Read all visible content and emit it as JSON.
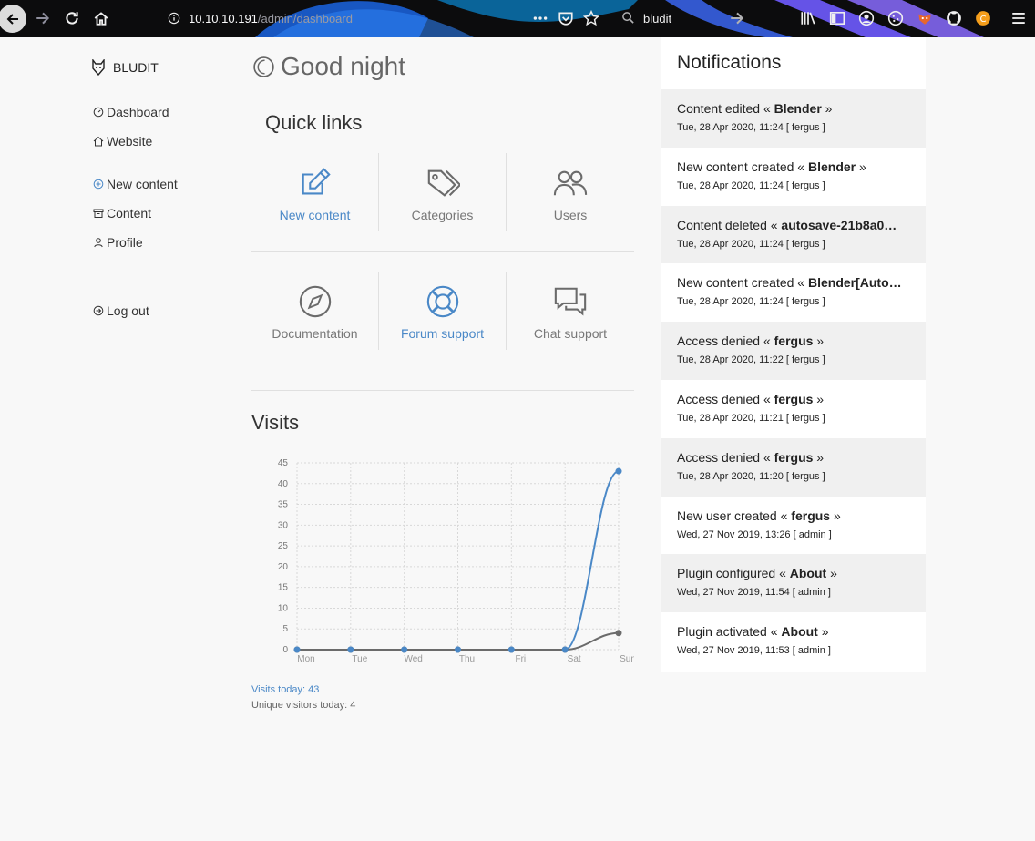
{
  "browser": {
    "url_host": "10.10.10.191",
    "url_path": "/admin/dashboard",
    "search_text": "bludit"
  },
  "sidebar": {
    "brand": "BLUDIT",
    "items": [
      {
        "label": "Dashboard",
        "icon": "dashboard-icon"
      },
      {
        "label": "Website",
        "icon": "home-icon"
      },
      {
        "label": "New content",
        "icon": "plus-circle-icon"
      },
      {
        "label": "Content",
        "icon": "archive-icon"
      },
      {
        "label": "Profile",
        "icon": "user-icon"
      },
      {
        "label": "Log out",
        "icon": "logout-icon"
      }
    ]
  },
  "main": {
    "greeting": "Good night",
    "quick_links_title": "Quick links",
    "quick_links": [
      {
        "label": "New content",
        "icon": "pencil-square-icon"
      },
      {
        "label": "Categories",
        "icon": "tags-icon"
      },
      {
        "label": "Users",
        "icon": "users-icon"
      },
      {
        "label": "Documentation",
        "icon": "compass-icon"
      },
      {
        "label": "Forum support",
        "icon": "life-ring-icon"
      },
      {
        "label": "Chat support",
        "icon": "chat-icon"
      }
    ],
    "visits_title": "Visits",
    "visits_today": "Visits today: 43",
    "unique_today": "Unique visitors today: 4"
  },
  "chart_data": {
    "type": "line",
    "categories": [
      "Mon",
      "Tue",
      "Wed",
      "Thu",
      "Fri",
      "Sat",
      "Sun"
    ],
    "series": [
      {
        "values": [
          0,
          0,
          0,
          0,
          0,
          0,
          43
        ],
        "color": "#4a88c7"
      },
      {
        "values": [
          0,
          0,
          0,
          0,
          0,
          0,
          4
        ],
        "color": "#6b6b6b"
      }
    ],
    "yticks": [
      0,
      5,
      10,
      15,
      20,
      25,
      30,
      35,
      40,
      45
    ],
    "ylim": [
      0,
      45
    ],
    "grid": true
  },
  "notifications": {
    "title": "Notifications",
    "items": [
      {
        "prefix": "Content edited « ",
        "name": "Blender",
        "suffix": " »",
        "meta": "Tue, 28 Apr 2020, 11:24 [ fergus ]"
      },
      {
        "prefix": "New content created « ",
        "name": "Blender",
        "suffix": " »",
        "meta": "Tue, 28 Apr 2020, 11:24 [ fergus ]"
      },
      {
        "prefix": "Content deleted « ",
        "name": "autosave-21b8a0…",
        "suffix": "",
        "meta": "Tue, 28 Apr 2020, 11:24 [ fergus ]"
      },
      {
        "prefix": "New content created « ",
        "name": "Blender[Auto…",
        "suffix": "",
        "meta": "Tue, 28 Apr 2020, 11:24 [ fergus ]"
      },
      {
        "prefix": "Access denied « ",
        "name": "fergus",
        "suffix": " »",
        "meta": "Tue, 28 Apr 2020, 11:22 [ fergus ]"
      },
      {
        "prefix": "Access denied « ",
        "name": "fergus",
        "suffix": " »",
        "meta": "Tue, 28 Apr 2020, 11:21 [ fergus ]"
      },
      {
        "prefix": "Access denied « ",
        "name": "fergus",
        "suffix": " »",
        "meta": "Tue, 28 Apr 2020, 11:20 [ fergus ]"
      },
      {
        "prefix": "New user created « ",
        "name": "fergus",
        "suffix": " »",
        "meta": "Wed, 27 Nov 2019, 13:26 [ admin ]"
      },
      {
        "prefix": "Plugin configured « ",
        "name": "About",
        "suffix": " »",
        "meta": "Wed, 27 Nov 2019, 11:54 [ admin ]"
      },
      {
        "prefix": "Plugin activated « ",
        "name": "About",
        "suffix": " »",
        "meta": "Wed, 27 Nov 2019, 11:53 [ admin ]"
      }
    ]
  }
}
